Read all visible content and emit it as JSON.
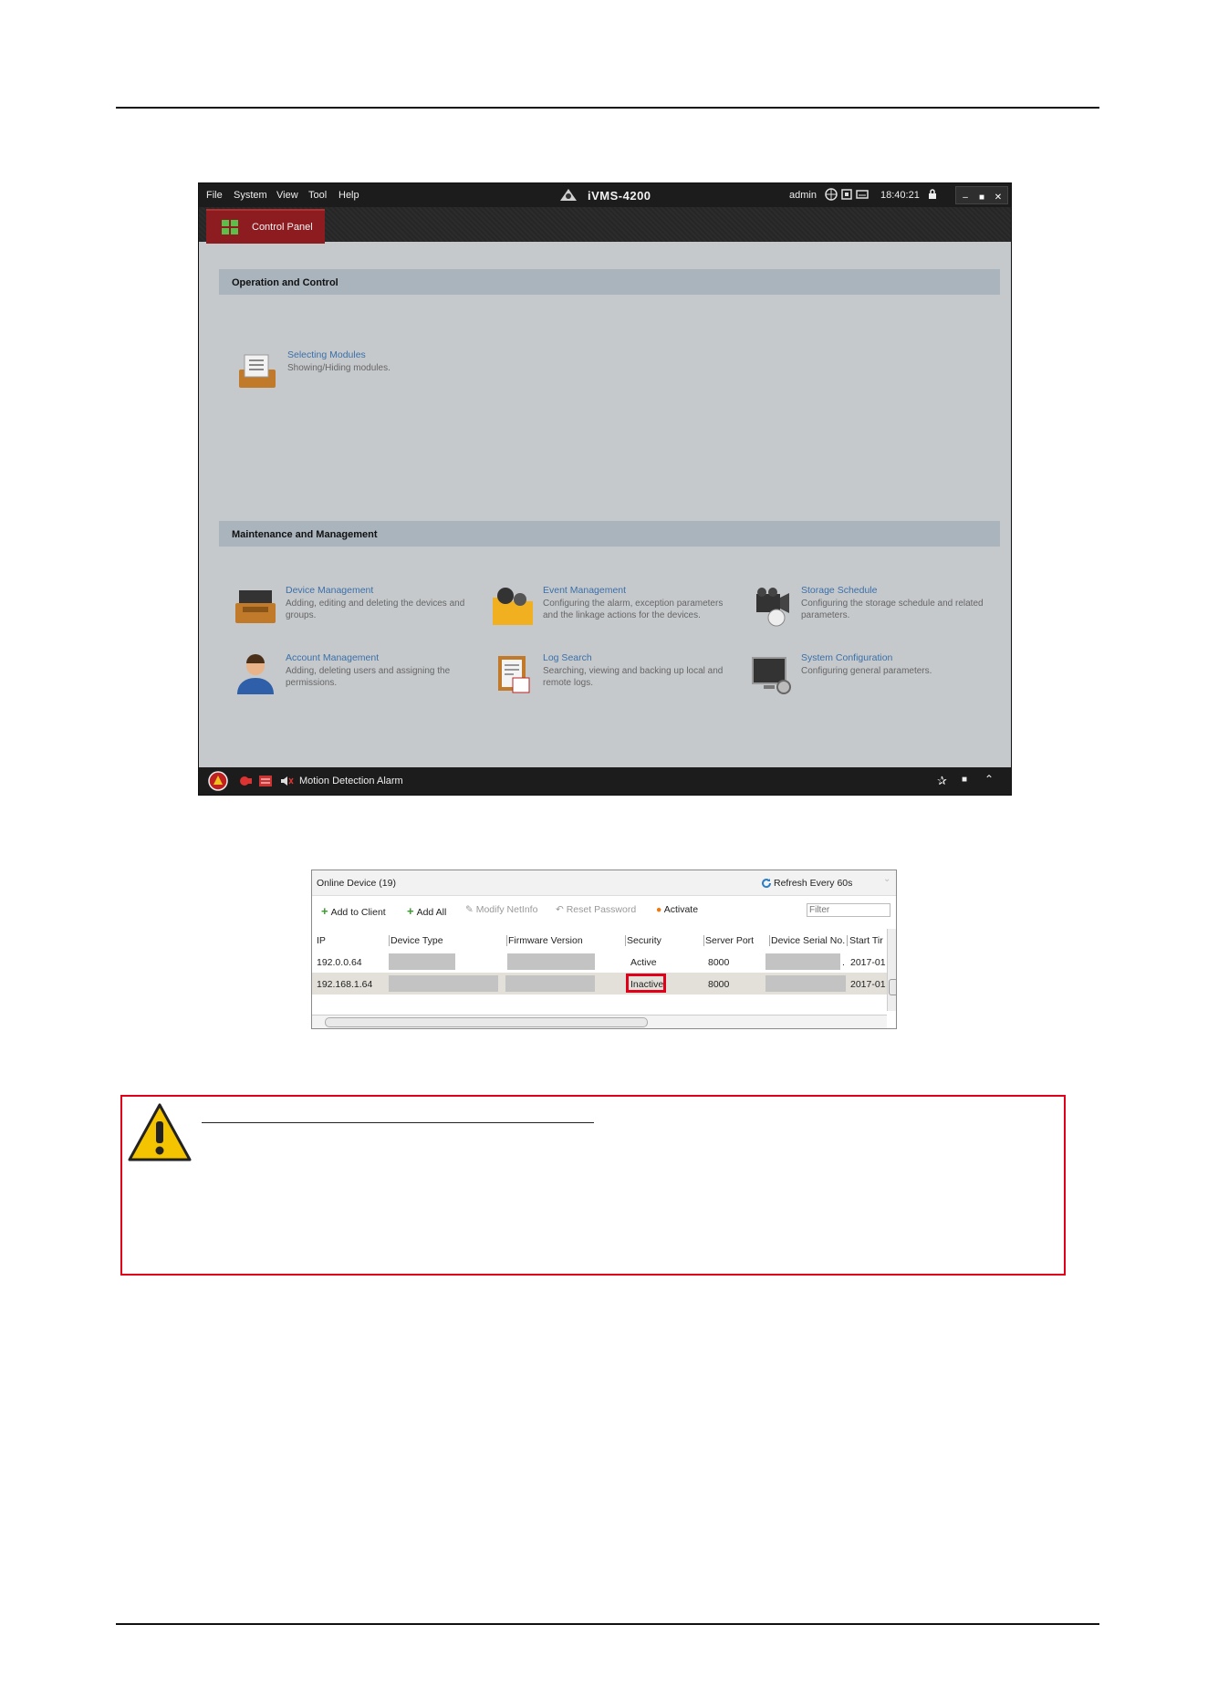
{
  "app": {
    "menu": [
      "File",
      "System",
      "View",
      "Tool",
      "Help"
    ],
    "title": "iVMS-4200",
    "user": "admin",
    "time": "18:40:21",
    "tab": "Control Panel",
    "sections": {
      "operation": "Operation and Control",
      "maintenance": "Maintenance and Management"
    },
    "modules": {
      "selecting": {
        "title": "Selecting Modules",
        "desc": "Showing/Hiding modules."
      },
      "device": {
        "title": "Device Management",
        "desc": "Adding, editing and deleting the devices and groups."
      },
      "event": {
        "title": "Event Management",
        "desc": "Configuring the alarm, exception parameters and the linkage actions for the devices."
      },
      "storage": {
        "title": "Storage Schedule",
        "desc": "Configuring the storage schedule and related parameters."
      },
      "account": {
        "title": "Account Management",
        "desc": "Adding, deleting users and assigning the permissions."
      },
      "log": {
        "title": "Log Search",
        "desc": "Searching, viewing and backing up local and remote logs."
      },
      "sysconfig": {
        "title": "System Configuration",
        "desc": "Configuring general parameters."
      }
    },
    "status": "Motion Detection Alarm"
  },
  "online_device": {
    "title": "Online Device (19)",
    "refresh": "Refresh Every 60s",
    "tools": {
      "add_client": "Add to Client",
      "add_all": "Add All",
      "modify_netinfo": "Modify NetInfo",
      "reset_password": "Reset Password",
      "activate": "Activate"
    },
    "filter_placeholder": "Filter",
    "columns": [
      "IP",
      "Device Type",
      "Firmware Version",
      "Security",
      "Server Port",
      "Device Serial No.",
      "Start Tir"
    ],
    "rows": [
      {
        "ip": "192.0.0.64",
        "security": "Active",
        "port": "8000",
        "serial_tail": ".",
        "start": "2017-01"
      },
      {
        "ip": "192.168.1.64",
        "security": "Inactive",
        "port": "8000",
        "serial_tail": "",
        "start": "2017-01"
      }
    ]
  },
  "colors": {
    "caution_border": "#e0001a",
    "tab_active": "#8d1c20",
    "module_title": "#3b6fa8"
  }
}
